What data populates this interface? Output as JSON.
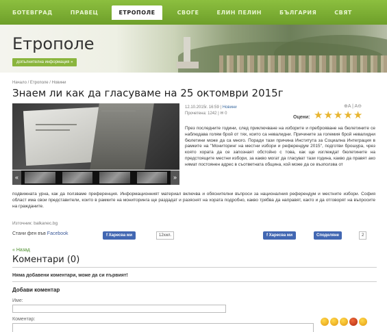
{
  "nav": {
    "items": [
      "БОТЕВГРАД",
      "ПРАВЕЦ",
      "ЕТРОПОЛЕ",
      "СВОГЕ",
      "ЕЛИН ПЕЛИН",
      "БЪЛГАРИЯ",
      "СВЯТ"
    ],
    "active_index": 2
  },
  "banner": {
    "city": "Етрополе",
    "more_info_label": "допълнителна информация »"
  },
  "breadcrumb": "Начало / Етрополе / Новини",
  "article": {
    "title": "Знаем ли как да гласуваме на 25 октомври 2015г",
    "date": "12.10.2015г. 16:59",
    "category": "Новини",
    "views": "Прочетена: 1242",
    "comments_count": "0",
    "font_tools": "⊕A | A⊖",
    "rating_label": "Оцени:",
    "rating_stars": 5,
    "body_right": "През последните години, след приключване на изборите и преброяване на бюлетините се наблюдава голям брой от тях, които са невалидни. Причините за големия брой невалидни бюлетини може да са много. Поради тази причина Института за Социална Интеграция в рамките на \"Мониторинг на местни избори и референдум 2015\", подготви брошура, чрез която хората да се запознаят обстойно с това, как ще изглеждат бюлетините на предстоящите местни избори, за какво могат да гласуват тази година, какво да правят ако нямат постоянен адрес в съответната община, кой може да се възползва от",
    "body_full": "подвижната урна, как да ползваме преференция. Информационният материал включва и обяснителни въпроси за националния референдум и местните избори. София област има свои представители, които в рамките на мониторинга ще раздадат и разяснят на хората подробно, какво трябва да направят, както и да отговорят на въпросите на гражданите.",
    "source": "Източник: balkanec.bg"
  },
  "social": {
    "fan_prefix": "Стани фен във",
    "fan_link": "Facebook",
    "like_label": "Харесва ми",
    "like_count": "12хил.",
    "like2_label": "Харесва ми",
    "share_label": "Споделяне",
    "share_count": "2"
  },
  "back_label": "« Назад",
  "comments": {
    "title": "Коментари (0)",
    "empty": "Няма добавени коментари, може да си първият!",
    "add_title": "Добави коментар",
    "name_label": "Име:",
    "comment_label": "Коментар:"
  },
  "colors": {
    "nav_green": "#7aad32",
    "link_green": "#4a8d2a",
    "facebook_blue": "#4267b2",
    "star_gold": "#e8b530"
  }
}
